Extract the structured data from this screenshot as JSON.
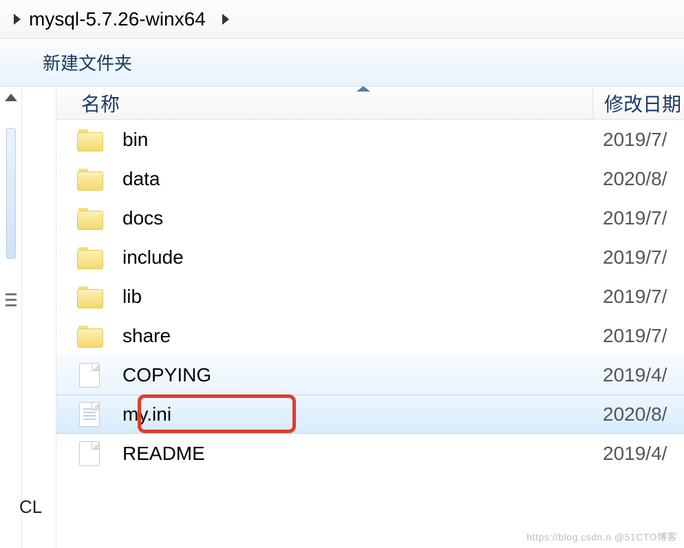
{
  "breadcrumb": {
    "current": "mysql-5.7.26-winx64"
  },
  "toolbar": {
    "new_folder": "新建文件夹"
  },
  "columns": {
    "name": "名称",
    "modified": "修改日期"
  },
  "tree": {
    "partial_label": "CL"
  },
  "files": [
    {
      "name": "bin",
      "date": "2019/7/",
      "type": "folder"
    },
    {
      "name": "data",
      "date": "2020/8/",
      "type": "folder"
    },
    {
      "name": "docs",
      "date": "2019/7/",
      "type": "folder"
    },
    {
      "name": "include",
      "date": "2019/7/",
      "type": "folder"
    },
    {
      "name": "lib",
      "date": "2019/7/",
      "type": "folder"
    },
    {
      "name": "share",
      "date": "2019/7/",
      "type": "folder"
    },
    {
      "name": "COPYING",
      "date": "2019/4/",
      "type": "file"
    },
    {
      "name": "my.ini",
      "date": "2020/8/",
      "type": "ini",
      "selected": true,
      "highlight": true
    },
    {
      "name": "README",
      "date": "2019/4/",
      "type": "file"
    }
  ],
  "watermark": "https://blog.csdn.n @51CTO博客"
}
